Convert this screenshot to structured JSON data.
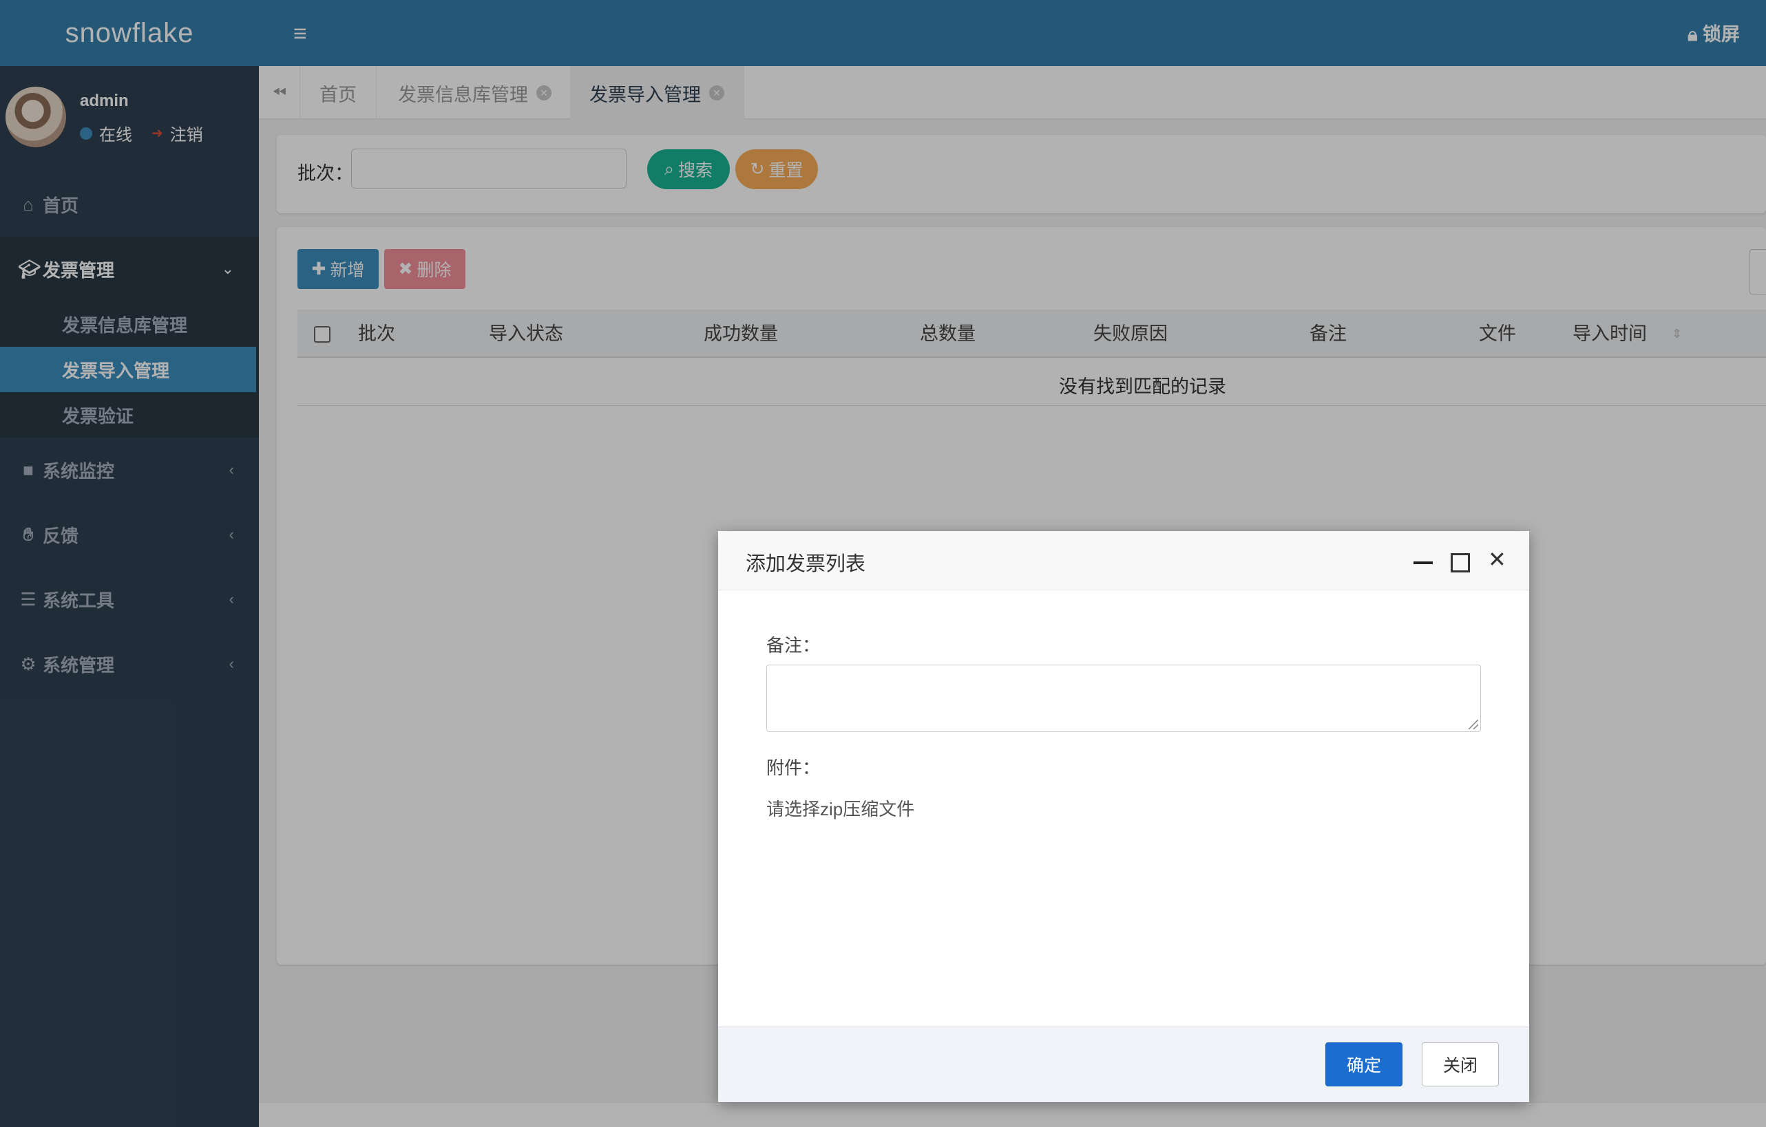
{
  "app": {
    "logo": "snowflake"
  },
  "user": {
    "name": "admin",
    "status": "在线",
    "logout": "注销"
  },
  "topbar": {
    "lock": "锁屏"
  },
  "sidebar": {
    "items": [
      {
        "label": "首页",
        "icon": "home-icon"
      },
      {
        "label": "发票管理",
        "icon": "graduation-cap-icon",
        "expanded": true,
        "children": [
          "发票信息库管理",
          "发票导入管理",
          "发票验证"
        ],
        "active_child": "发票导入管理"
      },
      {
        "label": "系统监控",
        "icon": "video-camera-icon"
      },
      {
        "label": "反馈",
        "icon": "handshake-icon"
      },
      {
        "label": "系统工具",
        "icon": "bars-icon"
      },
      {
        "label": "系统管理",
        "icon": "gear-icon"
      }
    ]
  },
  "tabs": [
    {
      "label": "首页"
    },
    {
      "label": "发票信息库管理"
    },
    {
      "label": "发票导入管理",
      "active": true
    }
  ],
  "search": {
    "batch_label": "批次：",
    "search_button": "搜索",
    "reset_button": "重置"
  },
  "toolbar": {
    "add_button": "新增",
    "delete_button": "删除"
  },
  "table": {
    "columns": [
      "批次",
      "导入状态",
      "成功数量",
      "总数量",
      "失败原因",
      "备注",
      "文件",
      "导入时间"
    ],
    "empty_text": "没有找到匹配的记录"
  },
  "modal": {
    "title": "添加发票列表",
    "remark_label": "备注：",
    "attachment_label": "附件：",
    "file_prompt": "请选择zip压缩文件",
    "ok_button": "确定",
    "close_button": "关闭"
  },
  "colors": {
    "sidebar": "#2f4050",
    "header": "#367fa9",
    "primary": "#3c8dbc",
    "success": "#1ab394",
    "warning": "#f8ac59",
    "danger": "#ed5565"
  }
}
